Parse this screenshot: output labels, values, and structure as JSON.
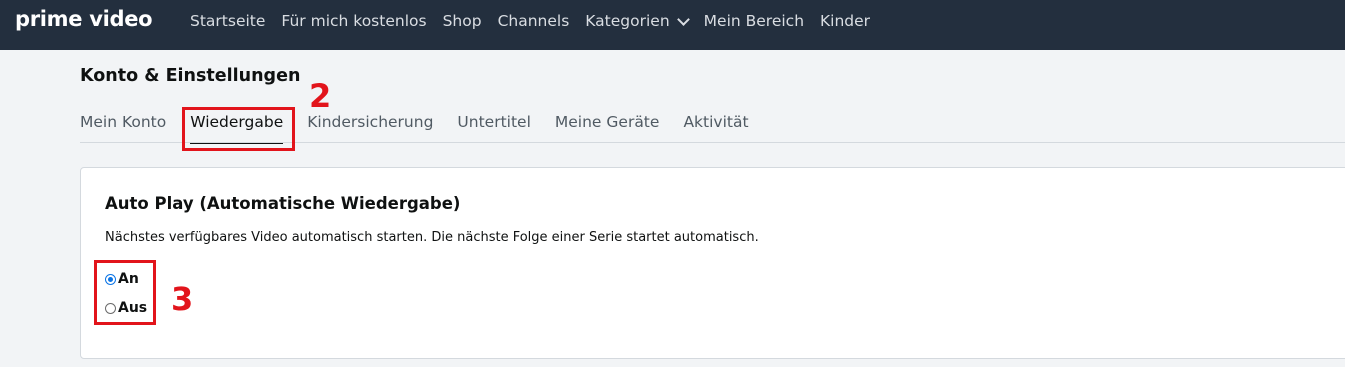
{
  "header": {
    "logo_text": "prime video",
    "nav": [
      {
        "label": "Startseite"
      },
      {
        "label": "Für mich kostenlos"
      },
      {
        "label": "Shop"
      },
      {
        "label": "Channels"
      },
      {
        "label": "Kategorien"
      },
      {
        "label": "Mein Bereich"
      },
      {
        "label": "Kinder"
      }
    ],
    "nav_dropdown_icon": "chevron-down-icon"
  },
  "page": {
    "title": "Konto & Einstellungen",
    "tabs": [
      {
        "label": "Mein Konto",
        "active": false
      },
      {
        "label": "Wiedergabe",
        "active": true
      },
      {
        "label": "Kindersicherung",
        "active": false
      },
      {
        "label": "Untertitel",
        "active": false
      },
      {
        "label": "Meine Geräte",
        "active": false
      },
      {
        "label": "Aktivität",
        "active": false
      }
    ]
  },
  "autoplay": {
    "title": "Auto Play (Automatische Wiedergabe)",
    "description": "Nächstes verfügbares Video automatisch starten. Die nächste Folge einer Serie startet automatisch.",
    "options": [
      {
        "label": "An",
        "selected": true
      },
      {
        "label": "Aus",
        "selected": false
      }
    ]
  },
  "annotations": {
    "step_tab": "2",
    "step_options": "3",
    "color": "#e2141b"
  },
  "colors": {
    "header_bg": "#232f3e",
    "page_bg": "#f2f4f6",
    "radio_accent": "#0b74e5"
  }
}
